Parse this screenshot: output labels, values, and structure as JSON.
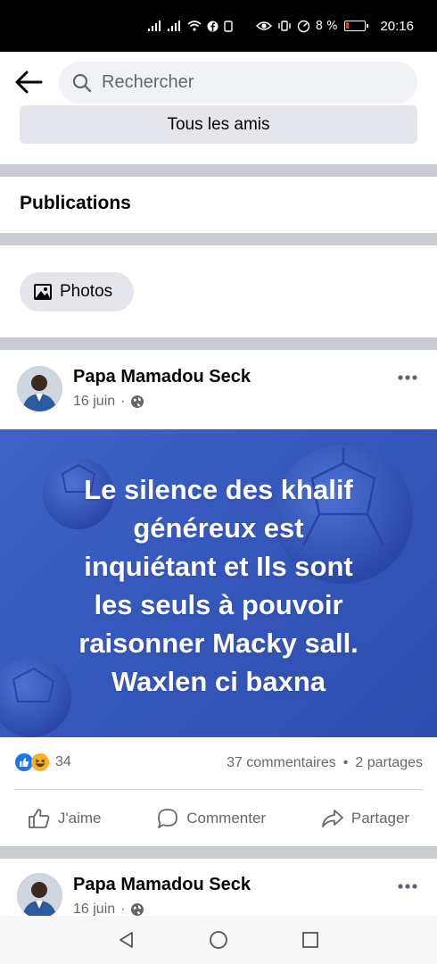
{
  "status_bar": {
    "battery": "8 %",
    "time": "20:16"
  },
  "search": {
    "placeholder": "Rechercher"
  },
  "friends": {
    "all_friends_label": "Tous les amis"
  },
  "publications": {
    "title": "Publications",
    "photos_chip": "Photos"
  },
  "post": {
    "author": "Papa Mamadou Seck",
    "date": "16 juin",
    "separator": "·",
    "text_lines": [
      "Le silence des khalif",
      "généreux est",
      "inquiétant et Ils sont",
      "les seuls à pouvoir",
      "raisonner Macky sall.",
      "Waxlen ci baxna"
    ],
    "reactions_count": "34",
    "comments": "37 commentaires",
    "dot": "•",
    "shares": "2 partages",
    "like_label": "J'aime",
    "comment_label": "Commenter",
    "share_label": "Partager",
    "background_color": "#3556ba"
  },
  "next_post": {
    "author": "Papa Mamadou Seck",
    "date": "16 juin",
    "separator": "·"
  },
  "colors": {
    "accent": "#1877f2",
    "divider": "#c9ccd1",
    "chip_bg": "#e4e6eb"
  }
}
